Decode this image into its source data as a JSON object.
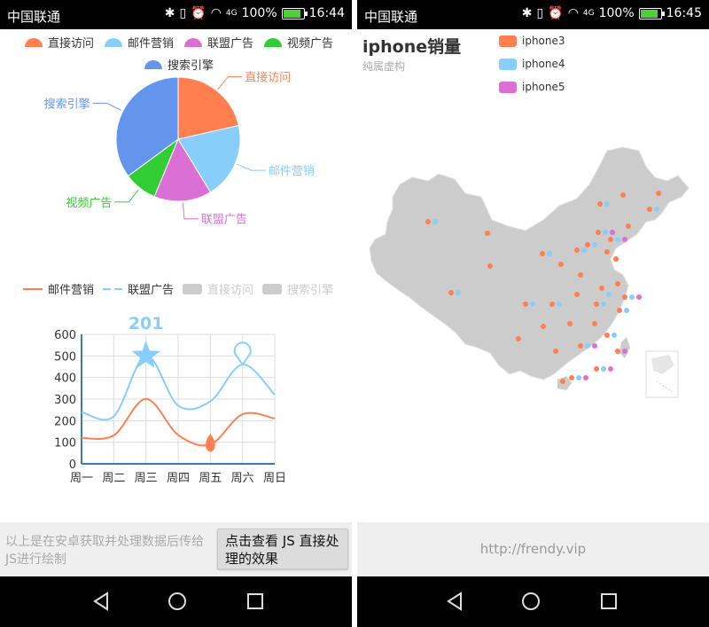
{
  "left": {
    "status": {
      "carrier": "中国联通",
      "network": "4G",
      "battery": "100%",
      "time": "16:44"
    },
    "pie_legend": [
      {
        "label": "直接访问",
        "color": "#ff7f50"
      },
      {
        "label": "邮件营销",
        "color": "#87cefa"
      },
      {
        "label": "联盟广告",
        "color": "#da70d6"
      },
      {
        "label": "视频广告",
        "color": "#32cd32"
      },
      {
        "label": "搜索引擎",
        "color": "#6495ed"
      }
    ],
    "line_legend": [
      {
        "label": "邮件营销",
        "color": "#ff7f50",
        "active": true
      },
      {
        "label": "联盟广告",
        "color": "#87cefa",
        "active": true
      },
      {
        "label": "直接访问",
        "color": "#cccccc",
        "active": false
      },
      {
        "label": "搜索引擎",
        "color": "#cccccc",
        "active": false
      }
    ],
    "description": "以上是在安卓获取并处理数据后传给JS进行绘制",
    "button_label": "点击查看 JS 直接处理的效果"
  },
  "right": {
    "status": {
      "carrier": "中国联通",
      "network": "4G",
      "battery": "100%",
      "time": "16:45"
    },
    "title": "iphone销量",
    "subtitle": "纯属虚构",
    "legend": [
      {
        "label": "iphone3",
        "color": "#ff7f50"
      },
      {
        "label": "iphone4",
        "color": "#87cefa"
      },
      {
        "label": "iphone5",
        "color": "#da70d6"
      }
    ],
    "url": "http://frendy.vip"
  },
  "chart_data": [
    {
      "type": "pie",
      "title": "",
      "categories": [
        "直接访问",
        "邮件营销",
        "联盟广告",
        "视频广告",
        "搜索引擎"
      ],
      "values": [
        335,
        310,
        234,
        135,
        548
      ],
      "colors": [
        "#ff7f50",
        "#87cefa",
        "#da70d6",
        "#32cd32",
        "#6495ed"
      ]
    },
    {
      "type": "line",
      "title": "",
      "categories": [
        "周一",
        "周二",
        "周三",
        "周四",
        "周五",
        "周六",
        "周日"
      ],
      "ylim": [
        0,
        600
      ],
      "yticks": [
        0,
        100,
        200,
        300,
        400,
        500,
        600
      ],
      "series": [
        {
          "name": "邮件营销",
          "values": [
            120,
            132,
            301,
            134,
            90,
            230,
            210
          ],
          "color": "#ff7f50",
          "min_marker": "周五"
        },
        {
          "name": "联盟广告",
          "values": [
            240,
            220,
            501,
            270,
            290,
            460,
            320
          ],
          "color": "#87cefa",
          "max_marker": "周三",
          "pin_marker": "周六"
        }
      ],
      "data_label": "201"
    }
  ]
}
